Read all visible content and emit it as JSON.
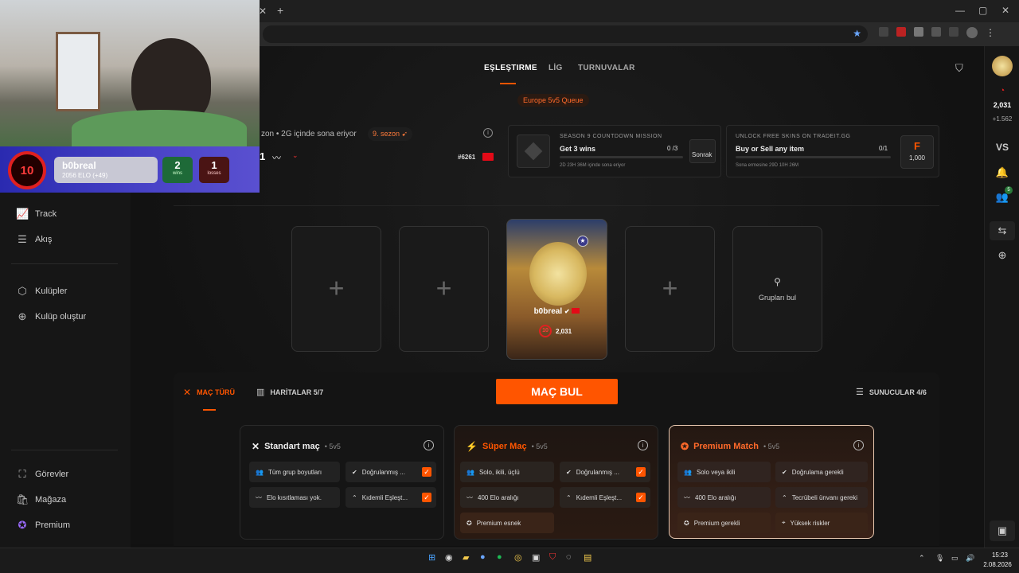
{
  "browser": {
    "tab_close": "✕",
    "new_tab": "+",
    "window_controls": [
      "—",
      "▢",
      "✕"
    ]
  },
  "topnav": {
    "tabs": [
      "EŞLEŞTIRME",
      "LİG",
      "TURNUVALAR"
    ],
    "queue_badge": "Europe 5v5 Queue"
  },
  "season": {
    "ends_text": "zon • 2G içinde sona eriyor",
    "season_label": "9. sezon",
    "rank": "#6261",
    "elo_partial": "1"
  },
  "missions": [
    {
      "header": "SEASON 9 COUNTDOWN MISSION",
      "name": "Get 3 wins",
      "progress": "0 /3",
      "timer": "2D 23H 36M içinde sona eriyor",
      "reward": "Sonrak"
    },
    {
      "header": "UNLOCK FREE SKINS ON TRADEIT.GG",
      "name": "Buy or Sell any item",
      "progress": "0/1",
      "timer": "Sona ermesine 29D 10H 26M",
      "reward": "1,000",
      "reward_icon": "F"
    }
  ],
  "overlay": {
    "level": "10",
    "name": "b0breal",
    "elo": "2056 ELO (+49)",
    "wins": "2",
    "wins_label": "wins",
    "losses": "1",
    "losses_label": "losses"
  },
  "sidebar": {
    "items": [
      {
        "label": "Track",
        "icon": "chart-icon"
      },
      {
        "label": "Akış",
        "icon": "feed-icon"
      },
      {
        "label": "Kulüpler",
        "icon": "club-icon"
      },
      {
        "label": "Kulüp oluştur",
        "icon": "plus-circle-icon"
      },
      {
        "label": "Görevler",
        "icon": "missions-icon"
      },
      {
        "label": "Mağaza",
        "icon": "shop-icon"
      },
      {
        "label": "Premium",
        "icon": "premium-icon"
      }
    ]
  },
  "party": {
    "player_name": "b0breal",
    "player_level": "10",
    "player_elo": "2,031",
    "find_groups": "Grupları bul"
  },
  "matchbar": {
    "match_type": "MAÇ TÜRÜ",
    "maps": "HARİTALAR 5/7",
    "find_match": "MAÇ BUL",
    "servers": "SUNUCULAR 4/6"
  },
  "modes": [
    {
      "title": "Standart maç",
      "sub": "• 5v5",
      "cells": [
        "Tüm grup boyutları",
        "Doğrulanmış ...",
        "Elo kısıtlaması yok.",
        "Kıdemli Eşleşt..."
      ]
    },
    {
      "title": "Süper Maç",
      "sub": "• 5v5",
      "cells": [
        "Solo, ikili, üçlü",
        "Doğrulanmış ...",
        "400 Elo aralığı",
        "Kıdemli Eşleşt...",
        "Premium esnek"
      ]
    },
    {
      "title": "Premium Match",
      "sub": "• 5v5",
      "cells": [
        "Solo veya ikili",
        "Doğrulama gerekli",
        "400 Elo aralığı",
        "Tecrübeli ünvanı gereki",
        "Premium gerekli",
        "Yüksek riskler"
      ]
    }
  ],
  "rightrail": {
    "elo": "2,031",
    "delta": "+1.562",
    "vs": "VS",
    "friends_badge": "5"
  },
  "taskbar": {
    "time": "15:23",
    "date": "2.08.2026"
  },
  "colors": {
    "accent": "#ff5500",
    "bg": "#111111"
  }
}
